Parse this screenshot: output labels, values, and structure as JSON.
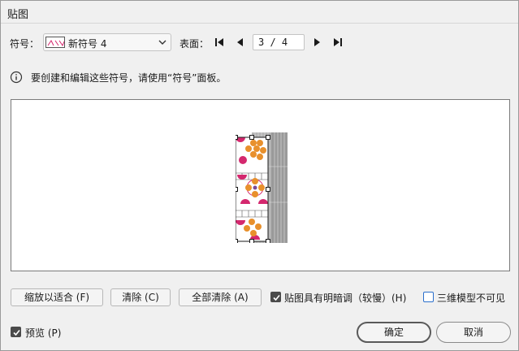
{
  "window": {
    "title": "贴图"
  },
  "symbol": {
    "label": "符号：",
    "selected": "新符号 4"
  },
  "surface": {
    "label": "表面：",
    "value": "3 / 4"
  },
  "info": {
    "text": "要创建和编辑这些符号，请使用“符号”面板。"
  },
  "buttons": {
    "zoom_fit": "缩放以适合 (F)",
    "clear": "清除 (C)",
    "clear_all": "全部清除 (A)",
    "ok": "确定",
    "cancel": "取消"
  },
  "options": {
    "shade_label": "贴图具有明暗调（较慢）(H)",
    "shade_checked": true,
    "invisible_label": "三维模型不可见",
    "invisible_checked": false,
    "preview_label": "预览 (P)",
    "preview_checked": true
  },
  "colors": {
    "accent": "#2a6fcc",
    "pink": "#d4286e",
    "orange": "#e8902c",
    "gray_band": "#9a9a9a"
  },
  "icons": {
    "info": "info-circle-icon",
    "first": "first-page-icon",
    "prev": "previous-icon",
    "next": "next-icon",
    "last": "last-page-icon",
    "dropdown": "chevron-down-icon"
  }
}
